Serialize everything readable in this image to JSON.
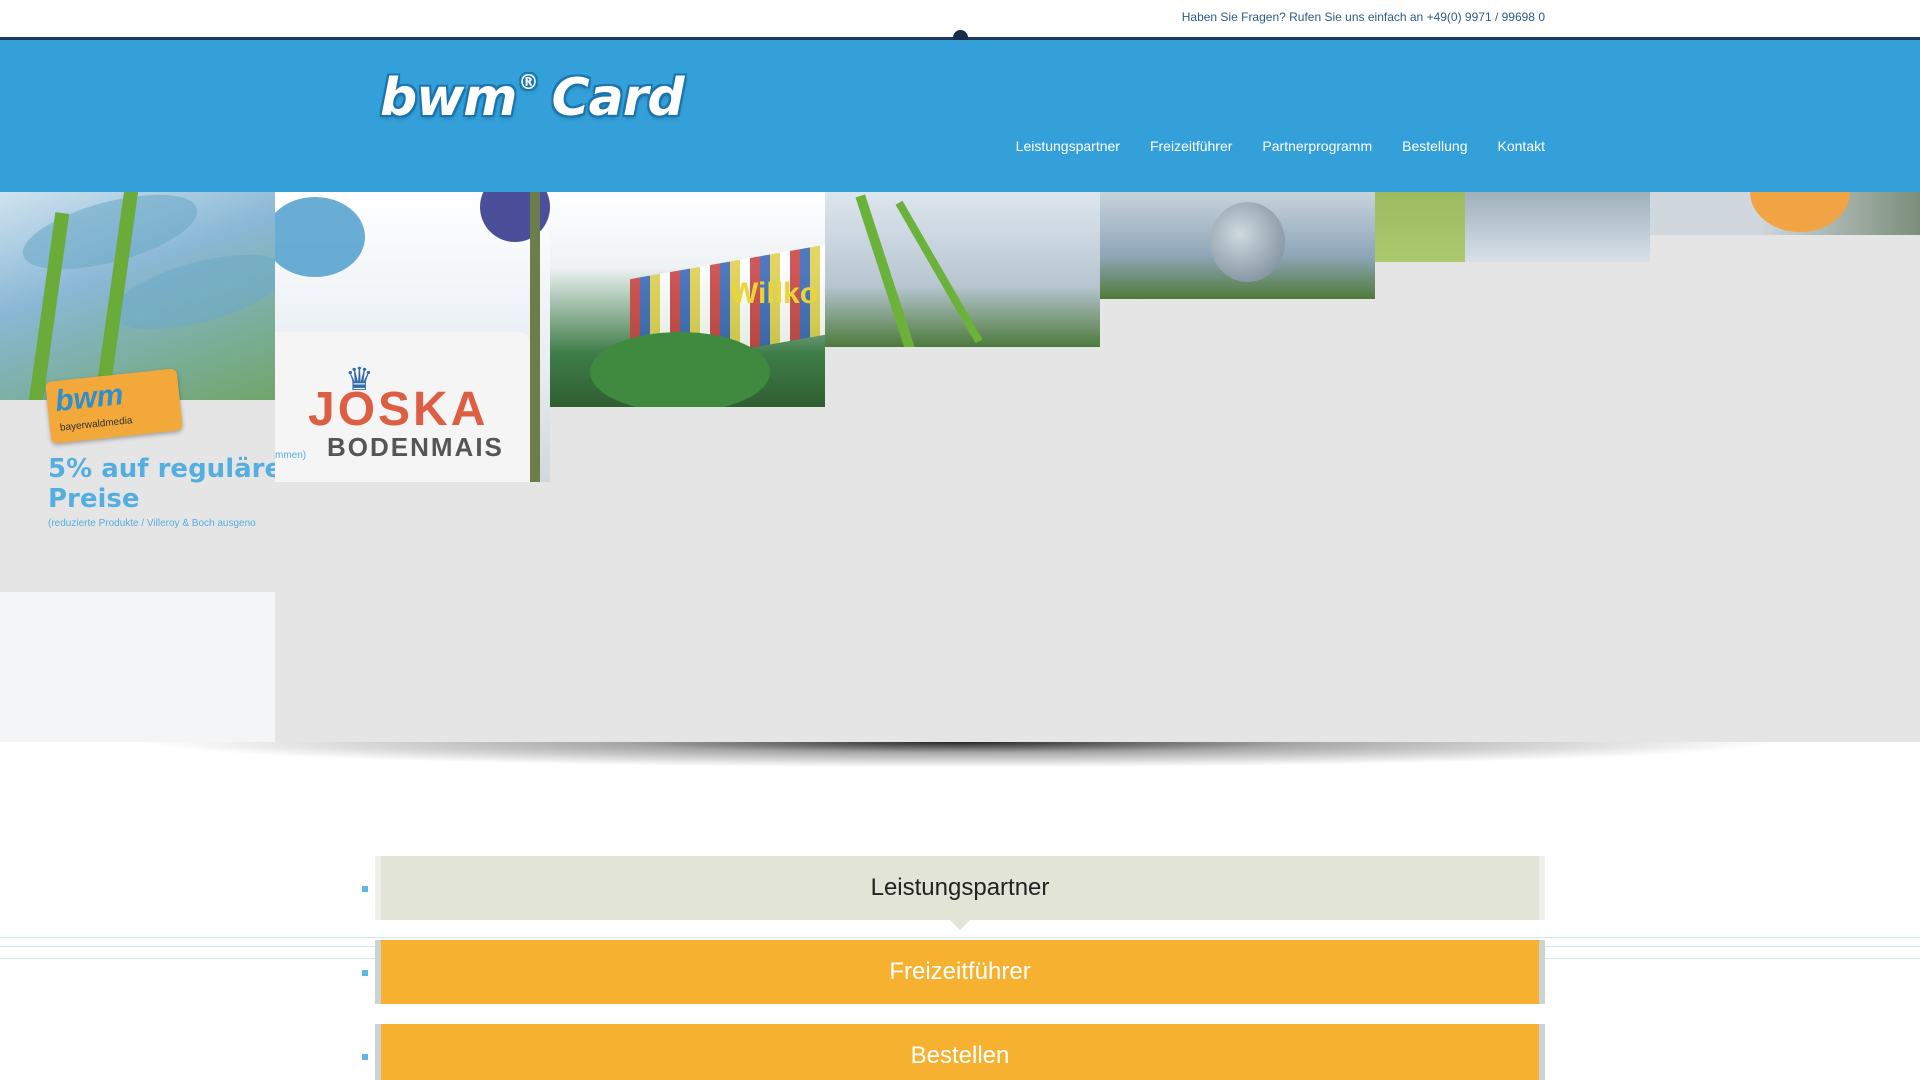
{
  "topbar": {
    "contact_text": "Haben Sie Fragen? Rufen Sie uns einfach an +49(0) 9971 / 99698 0"
  },
  "header": {
    "logo_text": "bwm",
    "logo_reg": "®",
    "logo_card": "Card",
    "nav": [
      {
        "label": "Leistungspartner"
      },
      {
        "label": "Freizeitführer"
      },
      {
        "label": "Partnerprogramm"
      },
      {
        "label": "Bestellung"
      },
      {
        "label": "Kontakt"
      }
    ]
  },
  "slider": {
    "card1": {
      "badge_text": "bwm",
      "badge_sub": "bayerwaldmedia",
      "main": "5% auf reguläre Preise",
      "note": "(reduzierte Produkte / Villeroy & Boch ausgeno",
      "cut_text": "mmen)"
    },
    "card2": {
      "crown": "♛",
      "brand": "JOSKA",
      "location": "BODENMAIS"
    },
    "tile3_text": "Willko"
  },
  "accordion": [
    {
      "label": "Leistungspartner"
    },
    {
      "label": "Freizeitführer"
    },
    {
      "label": "Bestellen"
    }
  ],
  "colors": {
    "header_blue": "#33a0d9",
    "accent_orange": "#f6b131",
    "active_tab": "#e3e4d8"
  }
}
